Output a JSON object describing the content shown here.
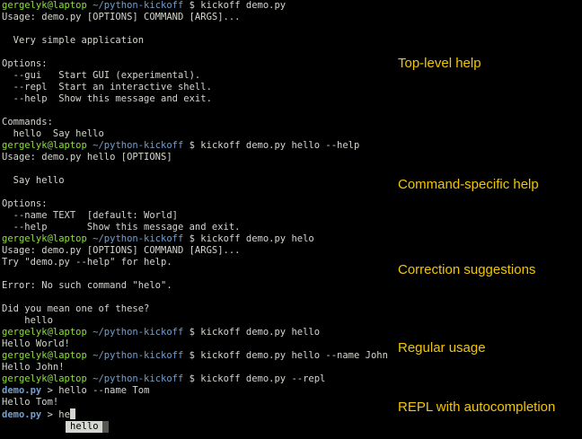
{
  "prompt": {
    "user": "gergelyk@laptop",
    "path": "~/python-kickoff",
    "symbol": "$"
  },
  "lines": [
    {
      "type": "prompt",
      "command": "kickoff demo.py"
    },
    {
      "type": "text",
      "text": "Usage: demo.py [OPTIONS] COMMAND [ARGS]..."
    },
    {
      "type": "text",
      "text": ""
    },
    {
      "type": "text",
      "text": "  Very simple application"
    },
    {
      "type": "text",
      "text": ""
    },
    {
      "type": "text",
      "text": "Options:"
    },
    {
      "type": "text",
      "text": "  --gui   Start GUI (experimental)."
    },
    {
      "type": "text",
      "text": "  --repl  Start an interactive shell."
    },
    {
      "type": "text",
      "text": "  --help  Show this message and exit."
    },
    {
      "type": "text",
      "text": ""
    },
    {
      "type": "text",
      "text": "Commands:"
    },
    {
      "type": "text",
      "text": "  hello  Say hello"
    },
    {
      "type": "prompt",
      "command": "kickoff demo.py hello --help"
    },
    {
      "type": "text",
      "text": "Usage: demo.py hello [OPTIONS]"
    },
    {
      "type": "text",
      "text": ""
    },
    {
      "type": "text",
      "text": "  Say hello"
    },
    {
      "type": "text",
      "text": ""
    },
    {
      "type": "text",
      "text": "Options:"
    },
    {
      "type": "text",
      "text": "  --name TEXT  [default: World]"
    },
    {
      "type": "text",
      "text": "  --help       Show this message and exit."
    },
    {
      "type": "prompt",
      "command": "kickoff demo.py helo"
    },
    {
      "type": "text",
      "text": "Usage: demo.py [OPTIONS] COMMAND [ARGS]..."
    },
    {
      "type": "text",
      "text": "Try \"demo.py --help\" for help."
    },
    {
      "type": "text",
      "text": ""
    },
    {
      "type": "text",
      "text": "Error: No such command \"helo\"."
    },
    {
      "type": "text",
      "text": ""
    },
    {
      "type": "text",
      "text": "Did you mean one of these?"
    },
    {
      "type": "text",
      "text": "    hello"
    },
    {
      "type": "prompt",
      "command": "kickoff demo.py hello"
    },
    {
      "type": "text",
      "text": "Hello World!"
    },
    {
      "type": "prompt",
      "command": "kickoff demo.py hello --name John"
    },
    {
      "type": "text",
      "text": "Hello John!"
    },
    {
      "type": "prompt",
      "command": "kickoff demo.py --repl"
    },
    {
      "type": "repl",
      "prompt": "demo.py",
      "input": "hello --name Tom"
    },
    {
      "type": "text",
      "text": "Hello Tom!"
    },
    {
      "type": "repl",
      "prompt": "demo.py",
      "input": "he",
      "cursor": true
    }
  ],
  "repl_marker": ">",
  "completion": {
    "suggestion": "hello"
  },
  "annotations": {
    "top_level_help": "Top-level help",
    "command_help": "Command-specific help",
    "correction": "Correction suggestions",
    "regular_usage": "Regular usage",
    "repl": "REPL with autocompletion"
  },
  "colors": {
    "background": "#000000",
    "text": "#d3d7cf",
    "user": "#8ae234",
    "path": "#729fcf",
    "annotation": "#f2c600"
  }
}
